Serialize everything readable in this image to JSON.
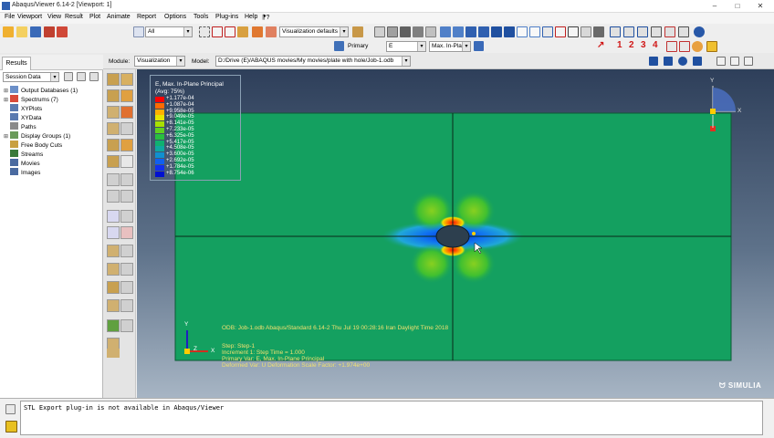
{
  "window": {
    "title": "Abaqus/Viewer 6.14-2 [Viewport: 1]",
    "minimize": "–",
    "maximize": "□",
    "close": "✕"
  },
  "menu": [
    "File",
    "Viewport",
    "View",
    "Result",
    "Plot",
    "Animate",
    "Report",
    "Options",
    "Tools",
    "Plug-ins",
    "Help",
    "⁋?"
  ],
  "toolbar": {
    "selection_filter": "All",
    "view_defaults": "Visualization defaults",
    "field_output_type": "Primary",
    "field_output_var": "E",
    "field_output_invariant": "Max. In-Plane",
    "step_numbers": [
      "1",
      "2",
      "3",
      "4"
    ]
  },
  "context": {
    "module_label": "Module:",
    "module_value": "Visualization",
    "model_label": "Model:",
    "model_value": "D:/Drive (E)/ABAQUS movies/My movies/plate with hole/Job-1.odb"
  },
  "tree": {
    "tab": "Results",
    "session_combo": "Session Data",
    "items": [
      {
        "label": "Output Databases (1)",
        "exp": "⊞",
        "color": "#6b8fc8"
      },
      {
        "label": "Spectrums (7)",
        "exp": "⊞",
        "color": "#d84a3a"
      },
      {
        "label": "XYPlots",
        "exp": "",
        "color": "#5a7ab0"
      },
      {
        "label": "XYData",
        "exp": "",
        "color": "#5a7ab0"
      },
      {
        "label": "Paths",
        "exp": "",
        "color": "#8a8a8a"
      },
      {
        "label": "Display Groups (1)",
        "exp": "⊞",
        "color": "#6a9a5a"
      },
      {
        "label": "Free Body Cuts",
        "exp": "",
        "color": "#c8a040"
      },
      {
        "label": "Streams",
        "exp": "",
        "color": "#3a7a3a"
      },
      {
        "label": "Movies",
        "exp": "",
        "color": "#4a6aa0"
      },
      {
        "label": "Images",
        "exp": "",
        "color": "#4a6aa0"
      }
    ]
  },
  "legend": {
    "title": "E, Max. In-Plane Principal",
    "subtitle": "(Avg: 75%)",
    "entries": [
      {
        "value": "+1.177e-04",
        "color": "#ff0000"
      },
      {
        "value": "+1.087e-04",
        "color": "#ff6a00"
      },
      {
        "value": "+9.958e-05",
        "color": "#ffb000"
      },
      {
        "value": "+9.049e-05",
        "color": "#e6e600"
      },
      {
        "value": "+8.141e-05",
        "color": "#a8e000"
      },
      {
        "value": "+7.233e-05",
        "color": "#60d020"
      },
      {
        "value": "+6.325e-05",
        "color": "#28c040"
      },
      {
        "value": "+5.417e-05",
        "color": "#10b070"
      },
      {
        "value": "+4.508e-05",
        "color": "#10a8a0"
      },
      {
        "value": "+3.600e-05",
        "color": "#1090d0"
      },
      {
        "value": "+2.692e-05",
        "color": "#1060f0"
      },
      {
        "value": "+1.784e-05",
        "color": "#1030f0"
      },
      {
        "value": "+8.754e-06",
        "color": "#0010d0"
      }
    ]
  },
  "viewport_info": {
    "odb_line": "ODB: Job-1.odb    Abaqus/Standard 6.14-2    Thu Jul 19 00:28:16 Iran Daylight Time 2018",
    "step_line": "Step: Step-1",
    "increment_line": "Increment      1: Step Time =      1.000",
    "primary_line": "Primary Var: E, Max. In-Plane Principal",
    "deformed_line": "Deformed Var: U   Deformation Scale Factor: +1.974e+00"
  },
  "triad": {
    "x": "X",
    "y": "Y",
    "z": "Z"
  },
  "brand": "SIMULIA",
  "messages": {
    "text": "STL Export plug-in is not available in Abaqus/Viewer"
  }
}
